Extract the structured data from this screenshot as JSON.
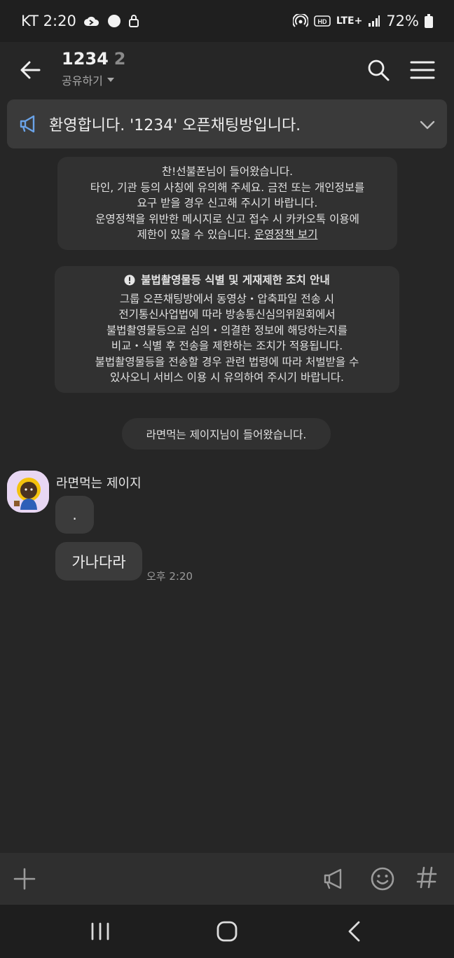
{
  "status_bar": {
    "carrier_time": "KT 2:20",
    "network": "LTE+",
    "battery": "72%"
  },
  "header": {
    "title": "1234",
    "member_count": "2",
    "share_label": "공유하기"
  },
  "notice": {
    "text": "환영합니다. '1234' 오픈채팅방입니다."
  },
  "system_messages": {
    "join_notice": {
      "line1": "찬!선불폰님이 들어왔습니다.",
      "line2": "타인, 기관 등의 사칭에 유의해 주세요. 금전 또는 개인정보를",
      "line3": "요구 받을 경우 신고해 주시기 바랍니다.",
      "line4": "운영정책을 위반한 메시지로 신고 접수 시 카카오톡 이용에",
      "line5_prefix": "제한이 있을 수 있습니다. ",
      "policy_link": "운영정책 보기"
    },
    "illegal_content": {
      "heading": "불법촬영물등 식별 및 게재제한 조치 안내",
      "line1": "그룹 오픈채팅방에서 동영상・압축파일 전송 시",
      "line2": "전기통신사업법에 따라 방송통신심의위원회에서",
      "line3": "불법촬영물등으로 심의・의결한 정보에 해당하는지를",
      "line4": "비교・식별 후 전송을 제한하는 조치가 적용됩니다.",
      "line5": "불법촬영물등을 전송할 경우 관련 법령에 따라 처벌받을 수",
      "line6": "있사오니 서비스 이용 시 유의하여 주시기 바랍니다."
    },
    "second_join": "라면먹는 제이지님이 들어왔습니다."
  },
  "messages": [
    {
      "sender": "라면먹는 제이지",
      "text": "."
    },
    {
      "sender": "라면먹는 제이지",
      "text": "가나다라",
      "time": "오후 2:20"
    }
  ],
  "colors": {
    "background": "#262626",
    "bubble": "#3b3b3b",
    "system_box": "#313131",
    "notice_icon": "#6aa3e8"
  }
}
